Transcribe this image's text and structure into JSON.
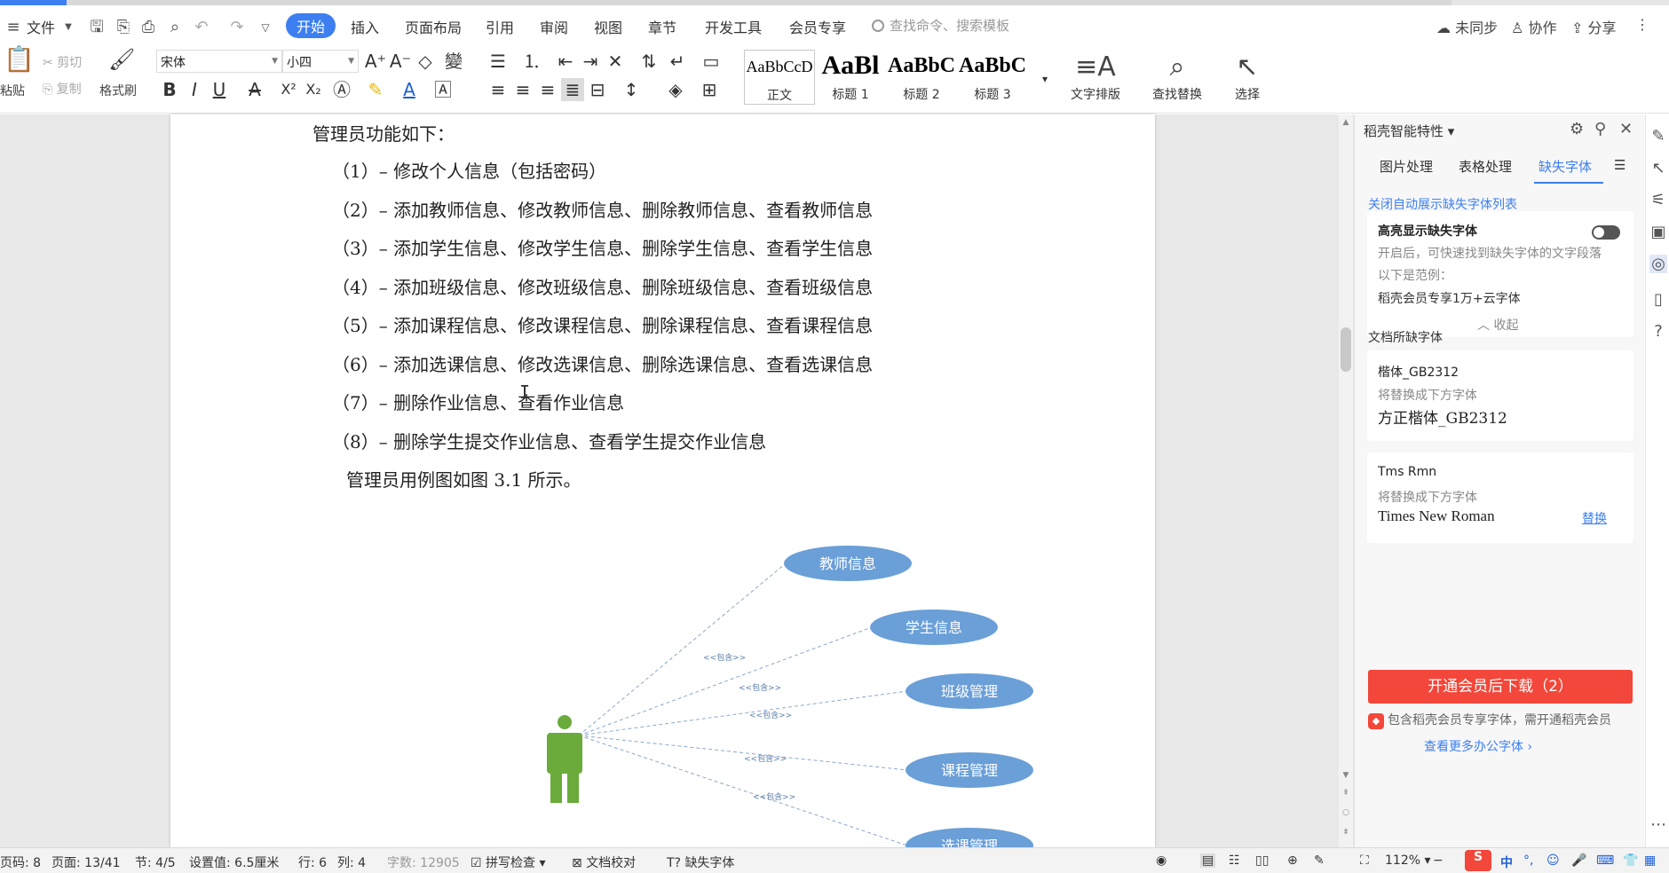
{
  "menubar": {
    "file_label": "文件",
    "tabs": [
      "开始",
      "插入",
      "页面布局",
      "引用",
      "审阅",
      "视图",
      "章节",
      "开发工具",
      "会员专享"
    ],
    "search_placeholder": "查找命令、搜索模板",
    "sync_label": "未同步",
    "collab_label": "协作",
    "share_label": "分享"
  },
  "ribbon": {
    "paste_label": "粘贴",
    "cut_label": "剪切",
    "copy_label": "复制",
    "format_painter_label": "格式刷",
    "font_name": "宋体",
    "font_size": "小四",
    "styles": [
      {
        "preview": "AaBbCcD",
        "label": "正文"
      },
      {
        "preview": "AaBl",
        "label": "标题 1"
      },
      {
        "preview": "AaBbC",
        "label": "标题 2"
      },
      {
        "preview": "AaBbC",
        "label": "标题 3"
      }
    ],
    "text_layout_label": "文字排版",
    "find_replace_label": "查找替换",
    "select_label": "选择"
  },
  "document": {
    "lines": [
      "管理员功能如下：",
      "（1）– 修改个人信息（包括密码）",
      "（2）– 添加教师信息、修改教师信息、删除教师信息、查看教师信息",
      "（3）– 添加学生信息、修改学生信息、删除学生信息、查看学生信息",
      "（4）– 添加班级信息、修改班级信息、删除班级信息、查看班级信息",
      "（5）– 添加课程信息、修改课程信息、删除课程信息、查看课程信息",
      "（6）– 添加选课信息、修改选课信息、删除选课信息、查看选课信息",
      "（7）– 删除作业信息、查看作业信息",
      "（8）– 删除学生提交作业信息、查看学生提交作业信息",
      "管理员用例图如图 3.1 所示。"
    ],
    "diagram": {
      "use_cases": [
        "教师信息",
        "学生信息",
        "班级管理",
        "课程管理",
        "选课管理"
      ],
      "include_label": "<<包含>>"
    }
  },
  "panel": {
    "title": "稻壳智能特性",
    "tabs": [
      "图片处理",
      "表格处理",
      "缺失字体"
    ],
    "close_auto_link": "关闭自动展示缺失字体列表",
    "highlight": {
      "title": "高亮显示缺失字体",
      "desc": "开启后，可快速找到缺失字体的文字段落",
      "example_label": "以下是范例：",
      "example_text": "稻壳会员专享1万+云字体",
      "collapse_label": "收起"
    },
    "missing_label": "文档所缺字体",
    "fonts": [
      {
        "name": "楷体_GB2312",
        "replace_hint": "将替换成下方字体",
        "replacement": "方正楷体_GB2312",
        "action": ""
      },
      {
        "name": "Tms Rmn",
        "replace_hint": "将替换成下方字体",
        "replacement": "Times New Roman",
        "action": "替换"
      }
    ],
    "download_button": "开通会员后下载（2）",
    "vip_note": "包含稻壳会员专享字体，需开通稻壳会员",
    "more_link": "查看更多办公字体 ›"
  },
  "statusbar": {
    "page_code": "页码: 8",
    "page": "页面: 13/41",
    "section": "节: 4/5",
    "position": "设置值: 6.5厘米",
    "row": "行: 6",
    "col": "列: 4",
    "word_count": "字数: 12905",
    "spell_check": "拼写检查",
    "doc_check": "文档校对",
    "missing_font": "缺失字体",
    "zoom": "112%",
    "ime": "中"
  },
  "colors": {
    "accent": "#3d7ff0",
    "danger": "#f2473a",
    "usecase_fill": "#6a9fd8",
    "actor": "#6aab3c"
  }
}
